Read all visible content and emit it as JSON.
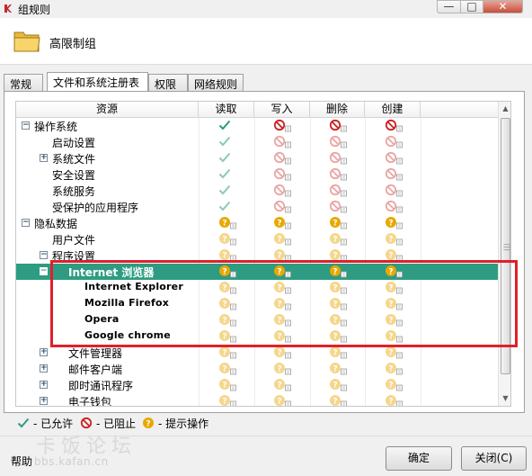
{
  "window": {
    "title": "组规则",
    "header_title": "高限制组",
    "min_glyph": "—",
    "max_glyph": "□",
    "close_glyph": "✕"
  },
  "tabs": [
    "常规",
    "文件和系统注册表",
    "权限",
    "网络规则"
  ],
  "columns": {
    "resource": "资源",
    "perms": [
      "读取",
      "写入",
      "删除",
      "创建"
    ]
  },
  "rows": [
    {
      "label": "操作系统",
      "level": 0,
      "expander": "−",
      "icons": [
        "allow",
        "block",
        "block",
        "block"
      ],
      "strong": true
    },
    {
      "label": "启动设置",
      "level": 1,
      "expander": "",
      "icons": [
        "allow",
        "block",
        "block",
        "block"
      ]
    },
    {
      "label": "系统文件",
      "level": 1,
      "expander": "+",
      "icons": [
        "allow",
        "block",
        "block",
        "block"
      ]
    },
    {
      "label": "安全设置",
      "level": 1,
      "expander": "",
      "icons": [
        "allow",
        "block",
        "block",
        "block"
      ]
    },
    {
      "label": "系统服务",
      "level": 1,
      "expander": "",
      "icons": [
        "allow",
        "block",
        "block",
        "block"
      ]
    },
    {
      "label": "受保护的应用程序",
      "level": 1,
      "expander": "",
      "icons": [
        "allow",
        "block",
        "block",
        "block"
      ]
    },
    {
      "label": "隐私数据",
      "level": 0,
      "expander": "−",
      "icons": [
        "prompt",
        "prompt",
        "prompt",
        "prompt"
      ],
      "strong": true
    },
    {
      "label": "用户文件",
      "level": 1,
      "expander": "",
      "icons": [
        "prompt",
        "prompt",
        "prompt",
        "prompt"
      ]
    },
    {
      "label": "程序设置",
      "level": 1,
      "expander": "−",
      "icons": [
        "prompt",
        "prompt",
        "prompt",
        "prompt"
      ]
    },
    {
      "label": "Internet 浏览器",
      "level": 2,
      "expander": "−",
      "icons": [
        "prompt",
        "prompt",
        "prompt",
        "prompt"
      ],
      "selected": true
    },
    {
      "label": "Internet Explorer",
      "level": 3,
      "expander": "",
      "icons": [
        "prompt",
        "prompt",
        "prompt",
        "prompt"
      ],
      "child": true
    },
    {
      "label": "Mozilla Firefox",
      "level": 3,
      "expander": "",
      "icons": [
        "prompt",
        "prompt",
        "prompt",
        "prompt"
      ],
      "child": true
    },
    {
      "label": "Opera",
      "level": 3,
      "expander": "",
      "icons": [
        "prompt",
        "prompt",
        "prompt",
        "prompt"
      ],
      "child": true
    },
    {
      "label": "Google chrome",
      "level": 3,
      "expander": "",
      "icons": [
        "prompt",
        "prompt",
        "prompt",
        "prompt"
      ],
      "child": true
    },
    {
      "label": "文件管理器",
      "level": 2,
      "expander": "+",
      "icons": [
        "prompt",
        "prompt",
        "prompt",
        "prompt"
      ]
    },
    {
      "label": "邮件客户端",
      "level": 2,
      "expander": "+",
      "icons": [
        "prompt",
        "prompt",
        "prompt",
        "prompt"
      ]
    },
    {
      "label": "即时通讯程序",
      "level": 2,
      "expander": "+",
      "icons": [
        "prompt",
        "prompt",
        "prompt",
        "prompt"
      ]
    },
    {
      "label": "电子钱包",
      "level": 2,
      "expander": "+",
      "icons": [
        "prompt",
        "prompt",
        "prompt",
        "prompt"
      ]
    }
  ],
  "legend": {
    "allow": "- 已允许",
    "block": "- 已阻止",
    "prompt": "- 提示操作"
  },
  "footer": {
    "help": "帮助",
    "ok": "确定",
    "close": "关闭(C)",
    "watermark": "卡饭论坛",
    "watermark_url": "bbs.kafan.cn"
  },
  "colors": {
    "allow": "#2e9c82",
    "block": "#cc2020",
    "prompt": "#e8a800",
    "selected": "#2e9c82",
    "highlight": "#e0202a"
  }
}
